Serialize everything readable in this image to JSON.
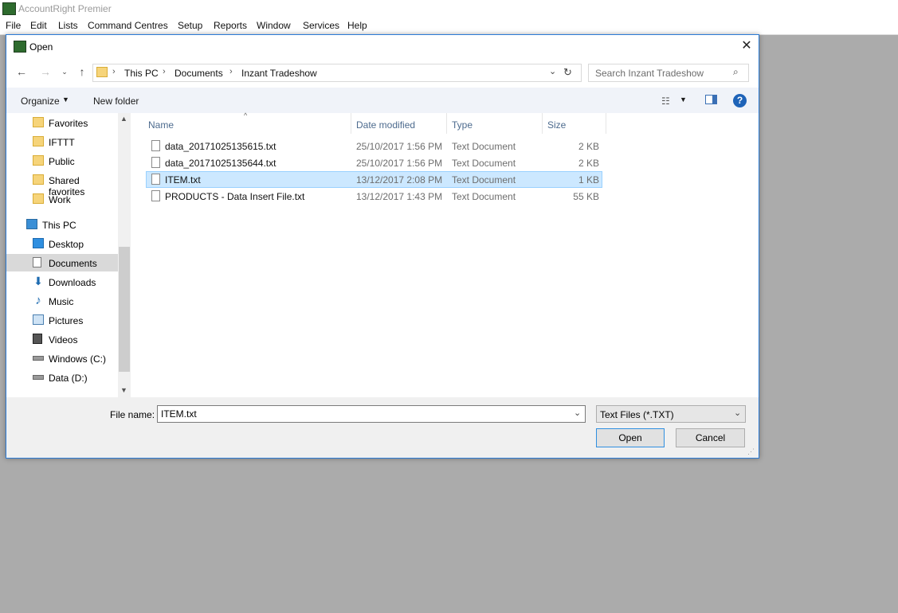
{
  "app": {
    "title": "AccountRight Premier"
  },
  "menu": [
    "File",
    "Edit",
    "Lists",
    "Command Centres",
    "Setup",
    "Reports",
    "Window",
    "Services",
    "Help"
  ],
  "dialog": {
    "title": "Open",
    "breadcrumb": [
      "This PC",
      "Documents",
      "Inzant Tradeshow"
    ],
    "search_placeholder": "Search Inzant Tradeshow",
    "toolbar": {
      "organize": "Organize",
      "new_folder": "New folder"
    },
    "nav": {
      "quick": [
        "Favorites",
        "IFTTT",
        "Public",
        "Shared favorites",
        "Work"
      ],
      "this_pc": "This PC",
      "pc_items": [
        "Desktop",
        "Documents",
        "Downloads",
        "Music",
        "Pictures",
        "Videos",
        "Windows (C:)",
        "Data (D:)"
      ],
      "selected": "Documents"
    },
    "columns": {
      "name": "Name",
      "date": "Date modified",
      "type": "Type",
      "size": "Size"
    },
    "files": [
      {
        "name": "data_20171025135615.txt",
        "date": "25/10/2017 1:56 PM",
        "type": "Text Document",
        "size": "2 KB"
      },
      {
        "name": "data_20171025135644.txt",
        "date": "25/10/2017 1:56 PM",
        "type": "Text Document",
        "size": "2 KB"
      },
      {
        "name": "ITEM.txt",
        "date": "13/12/2017 2:08 PM",
        "type": "Text Document",
        "size": "1 KB"
      },
      {
        "name": "PRODUCTS - Data Insert File.txt",
        "date": "13/12/2017 1:43 PM",
        "type": "Text Document",
        "size": "55 KB"
      }
    ],
    "selected_file": "ITEM.txt",
    "file_name_label": "File name:",
    "file_name_value": "ITEM.txt",
    "file_type": "Text Files (*.TXT)",
    "open_label": "Open",
    "cancel_label": "Cancel"
  }
}
